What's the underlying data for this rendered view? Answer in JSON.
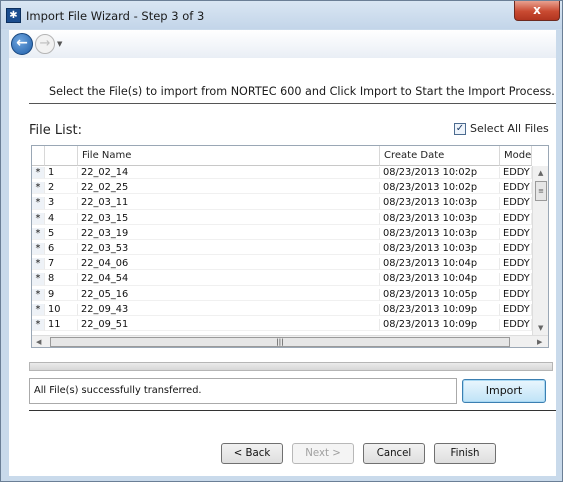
{
  "window": {
    "title": "Import File Wizard - Step 3 of 3",
    "close_label": "x"
  },
  "nav": {
    "back_icon": "back-arrow-icon",
    "forward_icon": "forward-arrow-icon"
  },
  "instruction": "Select the File(s) to import from NORTEC 600 and Click Import to Start the Import Process.",
  "file_list": {
    "label": "File List:",
    "select_all_label": "Select All Files",
    "select_all_checked": true,
    "columns": [
      "File Name",
      "Create Date",
      "Mode"
    ],
    "rows": [
      {
        "marker": "*",
        "num": "1",
        "name": "22_02_14",
        "date": "08/23/2013 10:02p",
        "mode": "EDDY"
      },
      {
        "marker": "*",
        "num": "2",
        "name": "22_02_25",
        "date": "08/23/2013 10:02p",
        "mode": "EDDY"
      },
      {
        "marker": "*",
        "num": "3",
        "name": "22_03_11",
        "date": "08/23/2013 10:03p",
        "mode": "EDDY"
      },
      {
        "marker": "*",
        "num": "4",
        "name": "22_03_15",
        "date": "08/23/2013 10:03p",
        "mode": "EDDY"
      },
      {
        "marker": "*",
        "num": "5",
        "name": "22_03_19",
        "date": "08/23/2013 10:03p",
        "mode": "EDDY"
      },
      {
        "marker": "*",
        "num": "6",
        "name": "22_03_53",
        "date": "08/23/2013 10:03p",
        "mode": "EDDY"
      },
      {
        "marker": "*",
        "num": "7",
        "name": "22_04_06",
        "date": "08/23/2013 10:04p",
        "mode": "EDDY"
      },
      {
        "marker": "*",
        "num": "8",
        "name": "22_04_54",
        "date": "08/23/2013 10:04p",
        "mode": "EDDY"
      },
      {
        "marker": "*",
        "num": "9",
        "name": "22_05_16",
        "date": "08/23/2013 10:05p",
        "mode": "EDDY"
      },
      {
        "marker": "*",
        "num": "10",
        "name": "22_09_43",
        "date": "08/23/2013 10:09p",
        "mode": "EDDY"
      },
      {
        "marker": "*",
        "num": "11",
        "name": "22_09_51",
        "date": "08/23/2013 10:09p",
        "mode": "EDDY"
      }
    ]
  },
  "status_text": "All File(s) successfully transferred.",
  "buttons": {
    "import": "Import",
    "back": "< Back",
    "next": "Next >",
    "cancel": "Cancel",
    "finish": "Finish"
  },
  "colors": {
    "accent": "#3c7fb1",
    "window_frame": "#c9daeb",
    "close_button": "#c94a31"
  }
}
